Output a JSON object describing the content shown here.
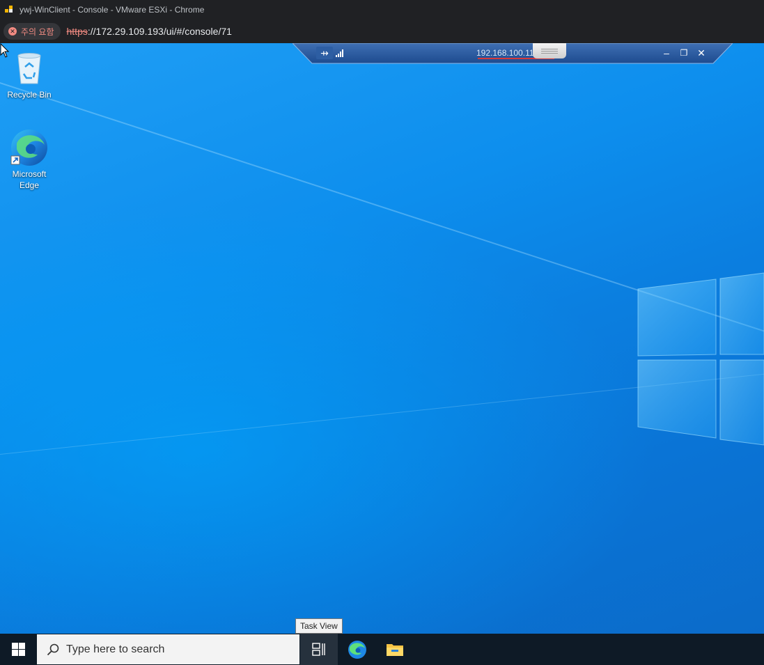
{
  "browser": {
    "window_title": "ywj-WinClient - Console - VMware ESXi - Chrome",
    "security_chip": "주의 요함",
    "url_scheme": "https",
    "url_rest": "://172.29.109.193/ui/#/console/71"
  },
  "vm_toolbar": {
    "ip_address": "192.168.100.110"
  },
  "desktop": {
    "icons": [
      {
        "label": "Recycle Bin"
      },
      {
        "label_line1": "Microsoft",
        "label_line2": "Edge"
      }
    ]
  },
  "tooltip": "Task View",
  "taskbar": {
    "search_placeholder": "Type here to search",
    "background_color": "#0e1a26"
  },
  "colors": {
    "desktop_accent": "#0d8eed",
    "warning": "#f28b82"
  }
}
